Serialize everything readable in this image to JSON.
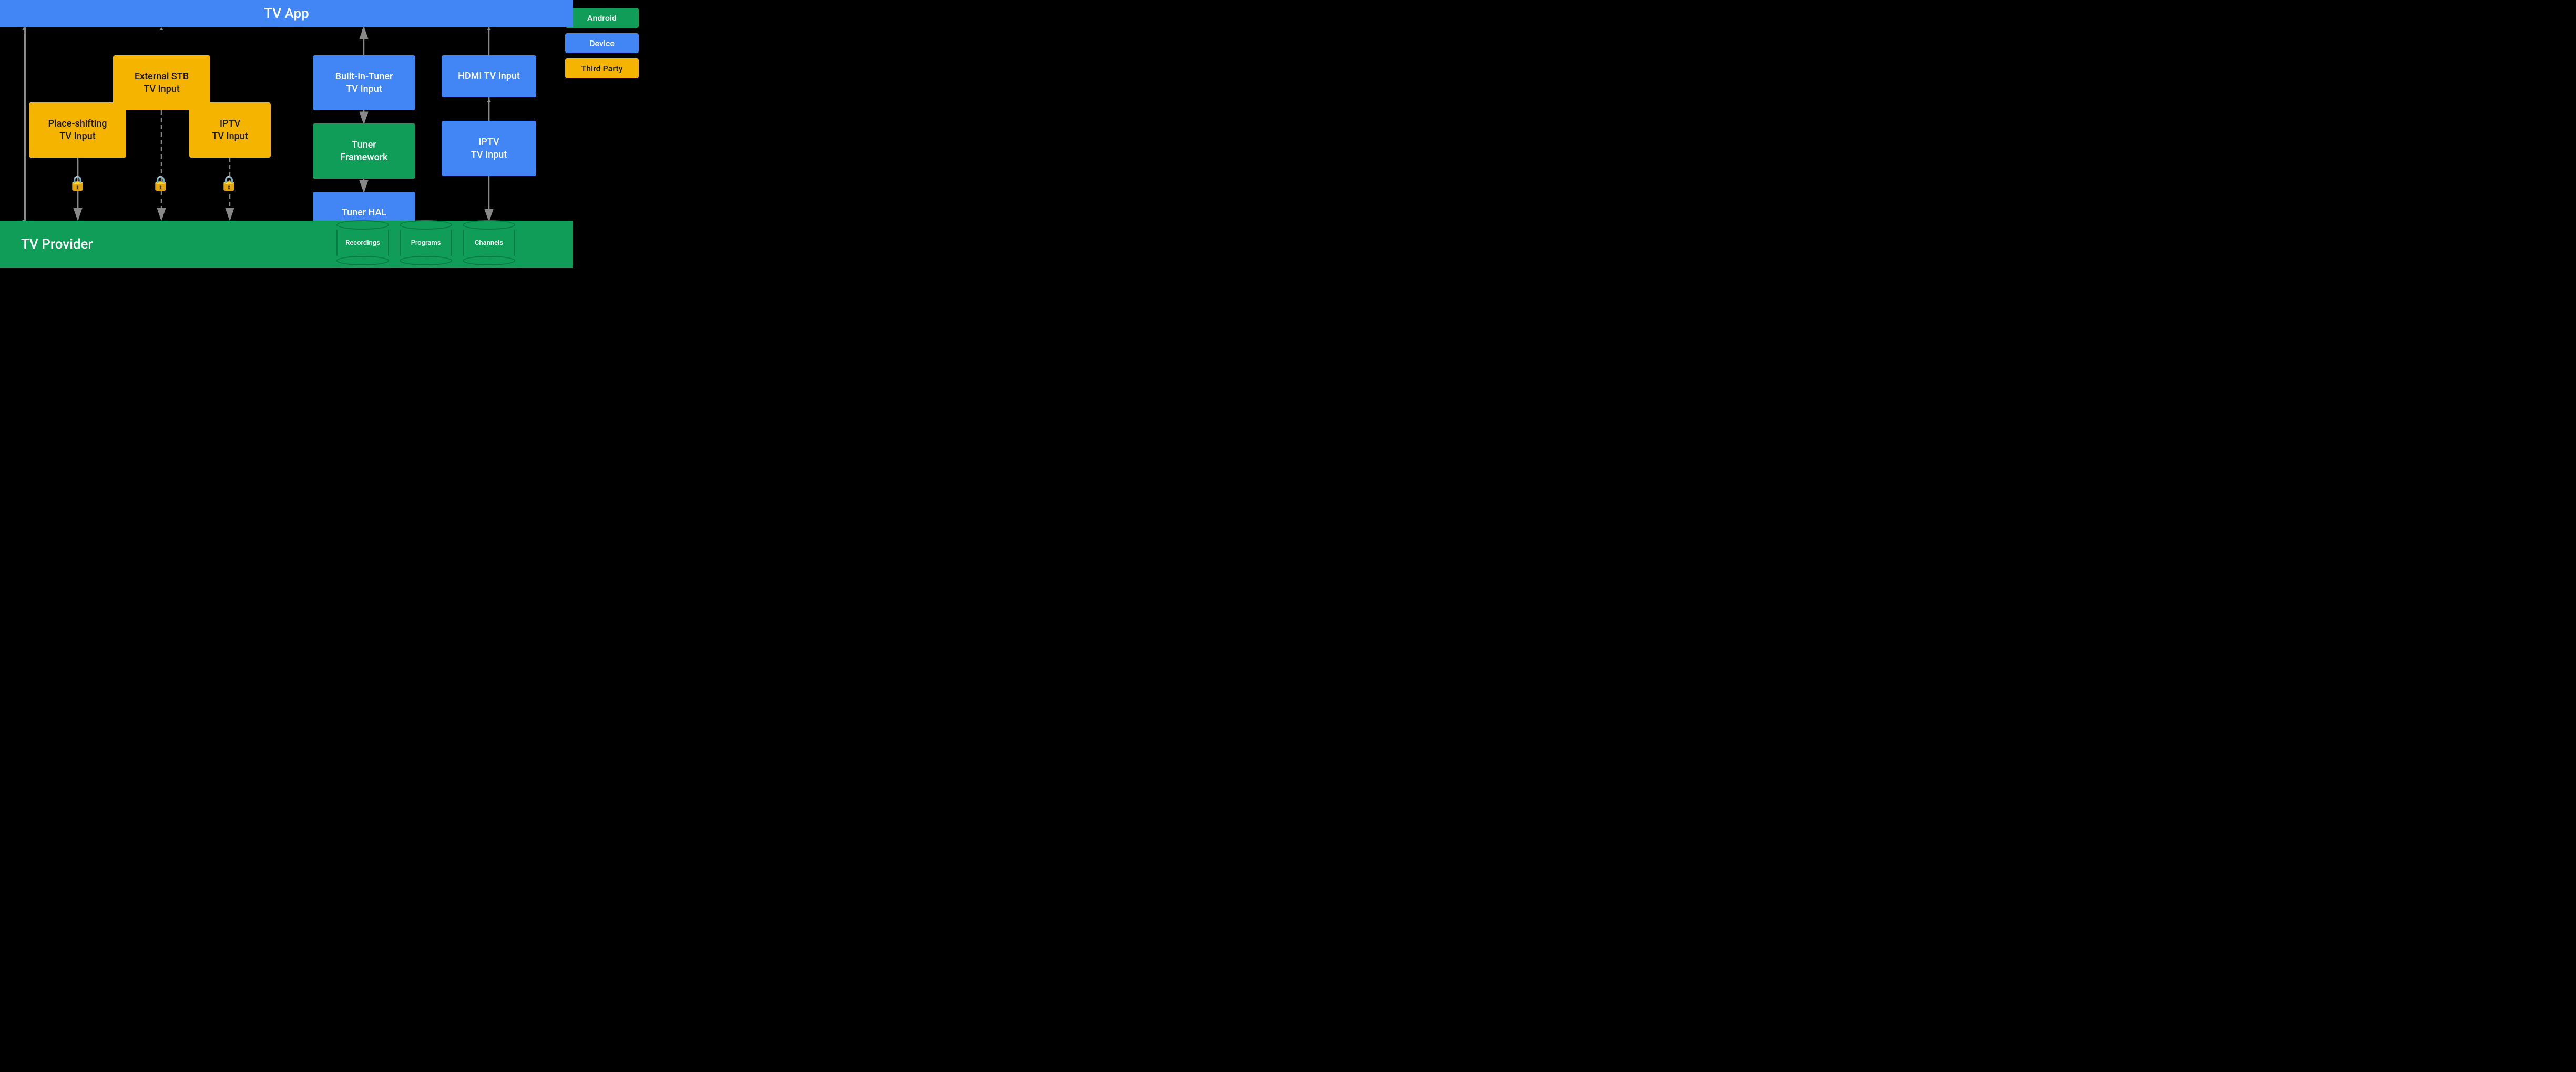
{
  "header": {
    "tv_app_label": "TV App"
  },
  "footer": {
    "tv_provider_label": "TV Provider"
  },
  "legend": {
    "android_label": "Android",
    "device_label": "Device",
    "third_party_label": "Third Party"
  },
  "boxes": {
    "external_stb": "External STB\nTV Input",
    "place_shifting": "Place-shifting\nTV Input",
    "iptv_left": "IPTV\nTV Input",
    "built_in_tuner": "Built-in-Tuner\nTV Input",
    "tuner_framework": "Tuner\nFramework",
    "tuner_hal": "Tuner HAL",
    "hdmi_tv_input": "HDMI TV Input",
    "iptv_right": "IPTV\nTV Input"
  },
  "databases": {
    "recordings": "Recordings",
    "programs": "Programs",
    "channels": "Channels"
  },
  "colors": {
    "orange": "#F4B400",
    "blue": "#4285F4",
    "green": "#0F9D58",
    "arrow": "#888888",
    "arrow_white": "#cccccc"
  }
}
